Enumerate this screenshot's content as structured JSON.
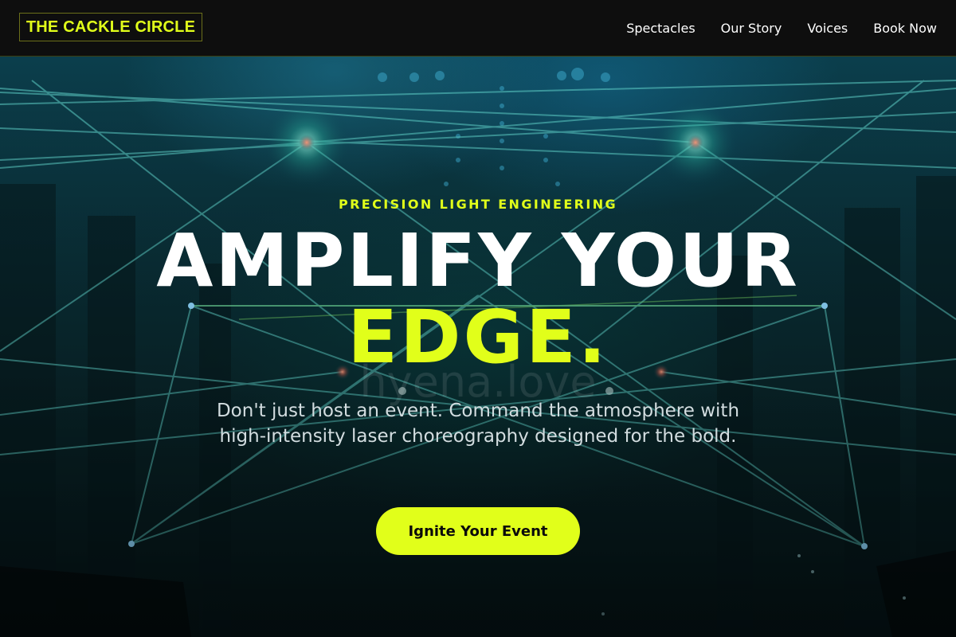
{
  "header": {
    "logo": "THE CACKLE CIRCLE",
    "nav": [
      {
        "label": "Spectacles"
      },
      {
        "label": "Our Story"
      },
      {
        "label": "Voices"
      },
      {
        "label": "Book Now"
      }
    ]
  },
  "hero": {
    "eyebrow": "PRECISION LIGHT ENGINEERING",
    "headline_line1": "AMPLIFY YOUR",
    "headline_line2": "EDGE.",
    "watermark": "hyena.love",
    "description": "Don't just host an event. Command the atmosphere with high-intensity laser choreography designed for the bold.",
    "cta_label": "Ignite Your Event"
  },
  "colors": {
    "accent": "#e1ff1a",
    "header_bg": "#0e0e0e",
    "hero_bg": "#0a2f37",
    "text_primary": "#ffffff",
    "text_secondary": "#d3dde0"
  }
}
